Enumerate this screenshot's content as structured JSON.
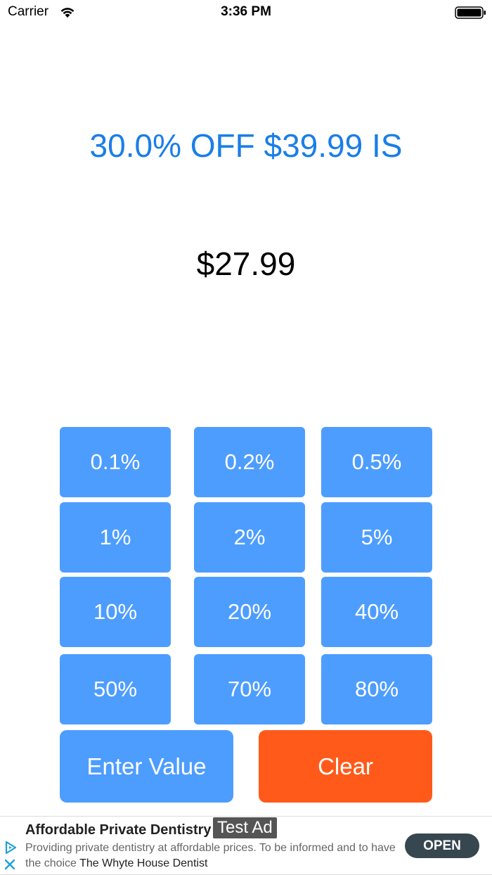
{
  "status_bar": {
    "carrier": "Carrier",
    "time": "3:36 PM"
  },
  "headline": "30.0% OFF $39.99 IS",
  "result": "$27.99",
  "percent_buttons": [
    "0.1%",
    "0.2%",
    "0.5%",
    "1%",
    "2%",
    "5%",
    "10%",
    "20%",
    "40%",
    "50%",
    "70%",
    "80%"
  ],
  "actions": {
    "enter_value": "Enter Value",
    "clear": "Clear"
  },
  "ad": {
    "title": "Affordable Private Dentistry",
    "badge": "Test Ad",
    "body": "Providing private dentistry at affordable prices. To be informed and to have the choice",
    "advertiser": "The Whyte House Dentist",
    "cta": "OPEN"
  },
  "colors": {
    "accent": "#1a7ee8",
    "button": "#4d9dff",
    "clear": "#ff5a1a",
    "cta": "#37474f"
  }
}
